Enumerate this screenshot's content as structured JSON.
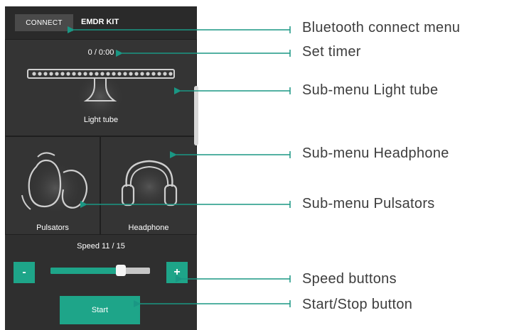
{
  "app": {
    "connect_label": "CONNECT",
    "title": "EMDR KIT",
    "timer": "0 / 0:00",
    "light_tube_label": "Light tube",
    "pulsators_label": "Pulsators",
    "headphone_label": "Headphone",
    "speed_label": "Speed 11 / 15",
    "minus_label": "-",
    "plus_label": "+",
    "start_label": "Start",
    "speed": {
      "value": 11,
      "max": 15
    }
  },
  "annotations": [
    {
      "text": "Bluetooth connect menu"
    },
    {
      "text": "Set timer"
    },
    {
      "text": "Sub-menu Light tube"
    },
    {
      "text": "Sub-menu Headphone"
    },
    {
      "text": "Sub-menu Pulsators"
    },
    {
      "text": "Speed buttons"
    },
    {
      "text": "Start/Stop button"
    }
  ],
  "colors": {
    "accent": "#1ea589",
    "annotation_text": "#3d3d3d",
    "arrow": "#1a9784",
    "panel_bg": "#343434"
  }
}
